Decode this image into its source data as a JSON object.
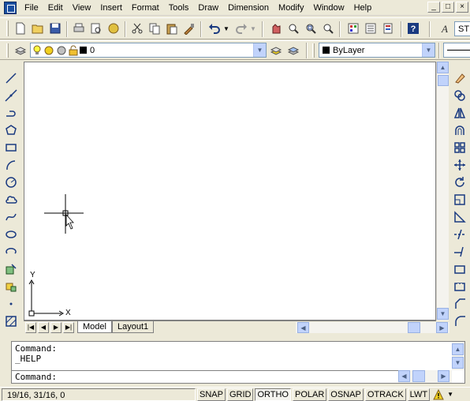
{
  "menu": {
    "items": [
      "File",
      "Edit",
      "View",
      "Insert",
      "Format",
      "Tools",
      "Draw",
      "Dimension",
      "Modify",
      "Window",
      "Help"
    ],
    "window_buttons": [
      "_",
      "□",
      "×"
    ]
  },
  "toolbar": {
    "layer_combo_value": "0",
    "color_combo_value": "ByLayer",
    "style_combo_value": "ST"
  },
  "drawing": {
    "ucs_x_label": "X",
    "ucs_y_label": "Y"
  },
  "tabs": {
    "items": [
      {
        "label": "Model",
        "active": true
      },
      {
        "label": "Layout1",
        "active": false
      }
    ]
  },
  "command": {
    "history": [
      "Command:",
      "_HELP"
    ],
    "prompt": "Command:"
  },
  "status": {
    "coordinates": "19/16, 31/16, 0",
    "toggles": [
      {
        "label": "SNAP",
        "on": false
      },
      {
        "label": "GRID",
        "on": false
      },
      {
        "label": "ORTHO",
        "on": true
      },
      {
        "label": "POLAR",
        "on": false
      },
      {
        "label": "OSNAP",
        "on": false
      },
      {
        "label": "OTRACK",
        "on": false
      },
      {
        "label": "LWT",
        "on": false
      }
    ]
  },
  "colors": {
    "accent": "#1a4fa0",
    "scroll": "#c1d3fb",
    "background": "#ece9d8"
  }
}
